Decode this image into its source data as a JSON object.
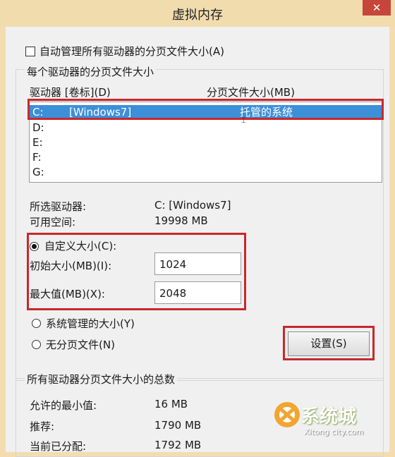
{
  "window": {
    "title": "虚拟内存",
    "close_label": "✕"
  },
  "auto_manage": {
    "label": "自动管理所有驱动器的分页文件大小(A)",
    "checked": false
  },
  "drive_group": {
    "label": "每个驱动器的分页文件大小",
    "col_drive": "驱动器 [卷标](D)",
    "col_size": "分页文件大小(MB)",
    "rows": [
      {
        "drive": "C:",
        "label": "[Windows7]",
        "size": "托管的系统",
        "selected": true
      },
      {
        "drive": "D:",
        "label": "",
        "size": "",
        "selected": false
      },
      {
        "drive": "E:",
        "label": "",
        "size": "",
        "selected": false
      },
      {
        "drive": "F:",
        "label": "",
        "size": "",
        "selected": false
      },
      {
        "drive": "G:",
        "label": "",
        "size": "",
        "selected": false
      }
    ]
  },
  "selected_drive": {
    "label": "所选驱动器:",
    "value": "C:  [Windows7]"
  },
  "free_space": {
    "label": "可用空间:",
    "value": "19998 MB"
  },
  "custom_size": {
    "label": "自定义大小(C):",
    "selected": true
  },
  "initial_size": {
    "label": "初始大小(MB)(I):",
    "value": "1024"
  },
  "max_size": {
    "label": "最大值(MB)(X):",
    "value": "2048"
  },
  "system_managed": {
    "label": "系统管理的大小(Y)",
    "selected": false
  },
  "no_paging": {
    "label": "无分页文件(N)",
    "selected": false
  },
  "set_button": {
    "label": "设置(S)"
  },
  "totals": {
    "label": "所有驱动器分页文件大小的总数",
    "min_label": "允许的最小值:",
    "min_value": "16 MB",
    "rec_label": "推荐:",
    "rec_value": "1790 MB",
    "cur_label": "当前已分配:",
    "cur_value": "1792 MB"
  },
  "watermark": {
    "text": "系统城",
    "sub": "Xitong city.com"
  },
  "colors": {
    "selection": "#3c8fd9",
    "highlight_box": "#c8282c"
  }
}
